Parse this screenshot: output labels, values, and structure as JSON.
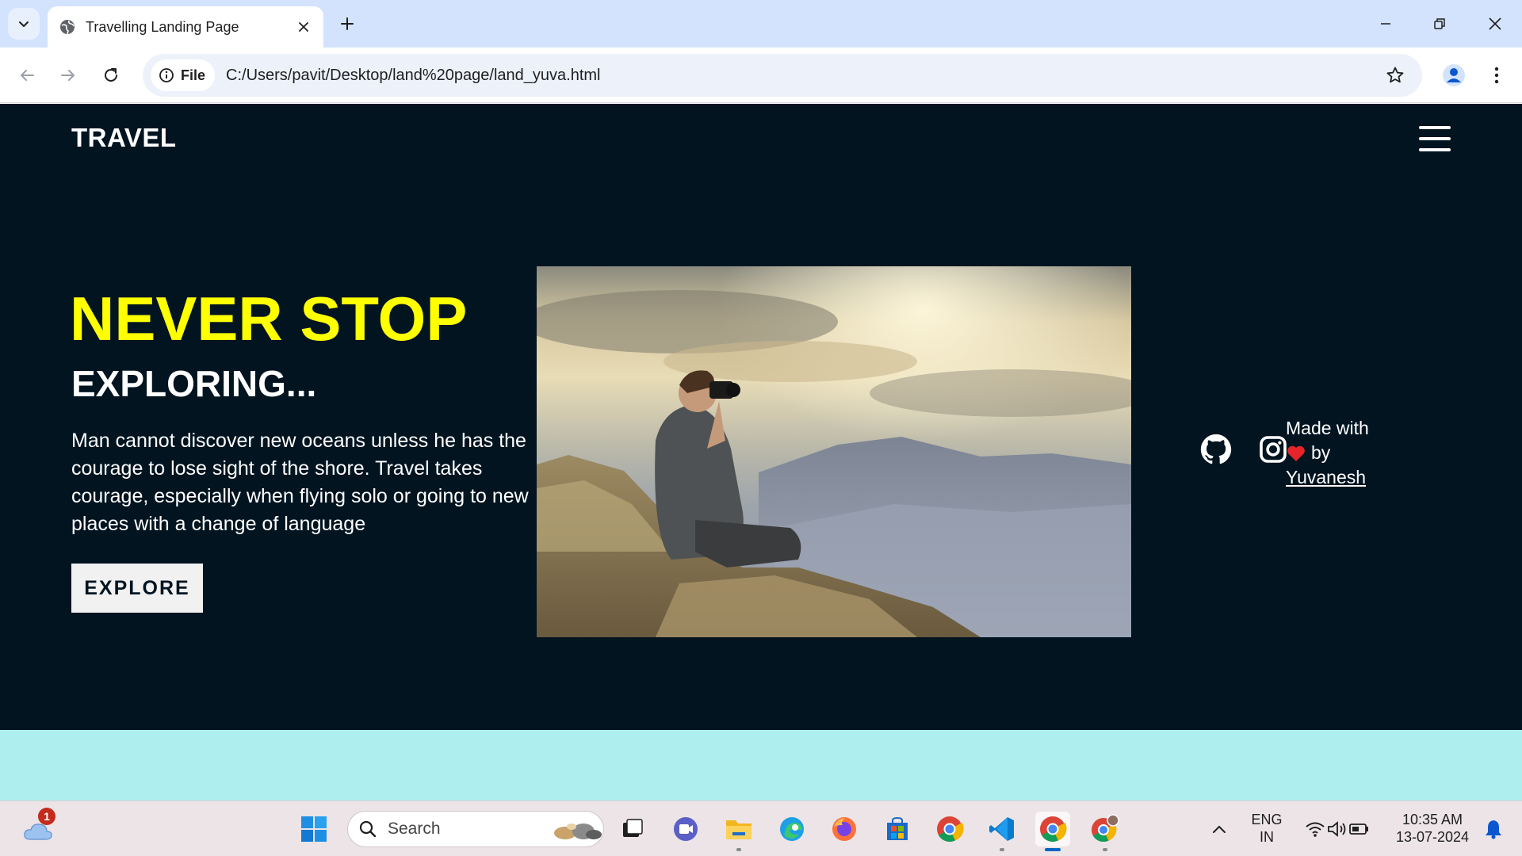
{
  "browser": {
    "tab_title": "Travelling Landing Page",
    "site_chip_label": "File",
    "url": "C:/Users/pavit/Desktop/land%20page/land_yuva.html",
    "icons": [
      "tab-search-icon",
      "globe-icon",
      "close-icon",
      "plus-icon",
      "minimize-icon",
      "restore-icon",
      "close-window-icon",
      "back-arrow-icon",
      "forward-arrow-icon",
      "reload-icon",
      "info-icon",
      "star-icon",
      "profile-icon",
      "more-vertical-icon"
    ]
  },
  "page": {
    "brand": "TRAVEL",
    "headline_primary": "NEVER STOP",
    "headline_secondary": "EXPLORING...",
    "description": "Man cannot discover new oceans unless he has the courage to lose sight of the shore. Travel takes courage, especially when flying solo or going to new places with a change of language",
    "cta_label": "EXPLORE",
    "credit_prefix": "Made with",
    "credit_suffix": "by",
    "credit_author": "Yuvanesh",
    "icons": [
      "hamburger-menu-icon",
      "github-icon",
      "instagram-icon",
      "heart-icon"
    ],
    "colors": {
      "hero_background": "#011420",
      "page_background": "#afeeee",
      "headline_accent": "#ffff00",
      "heart": "#e8242b"
    }
  },
  "taskbar": {
    "weather_badge": "1",
    "search_placeholder": "Search",
    "language_line1": "ENG",
    "language_line2": "IN",
    "time": "10:35 AM",
    "date": "13-07-2024",
    "apps": [
      "windows-start",
      "task-view",
      "meet",
      "file-explorer",
      "edge",
      "firefox",
      "microsoft-store",
      "chrome",
      "vscode",
      "chrome-active",
      "chrome-profile"
    ]
  }
}
